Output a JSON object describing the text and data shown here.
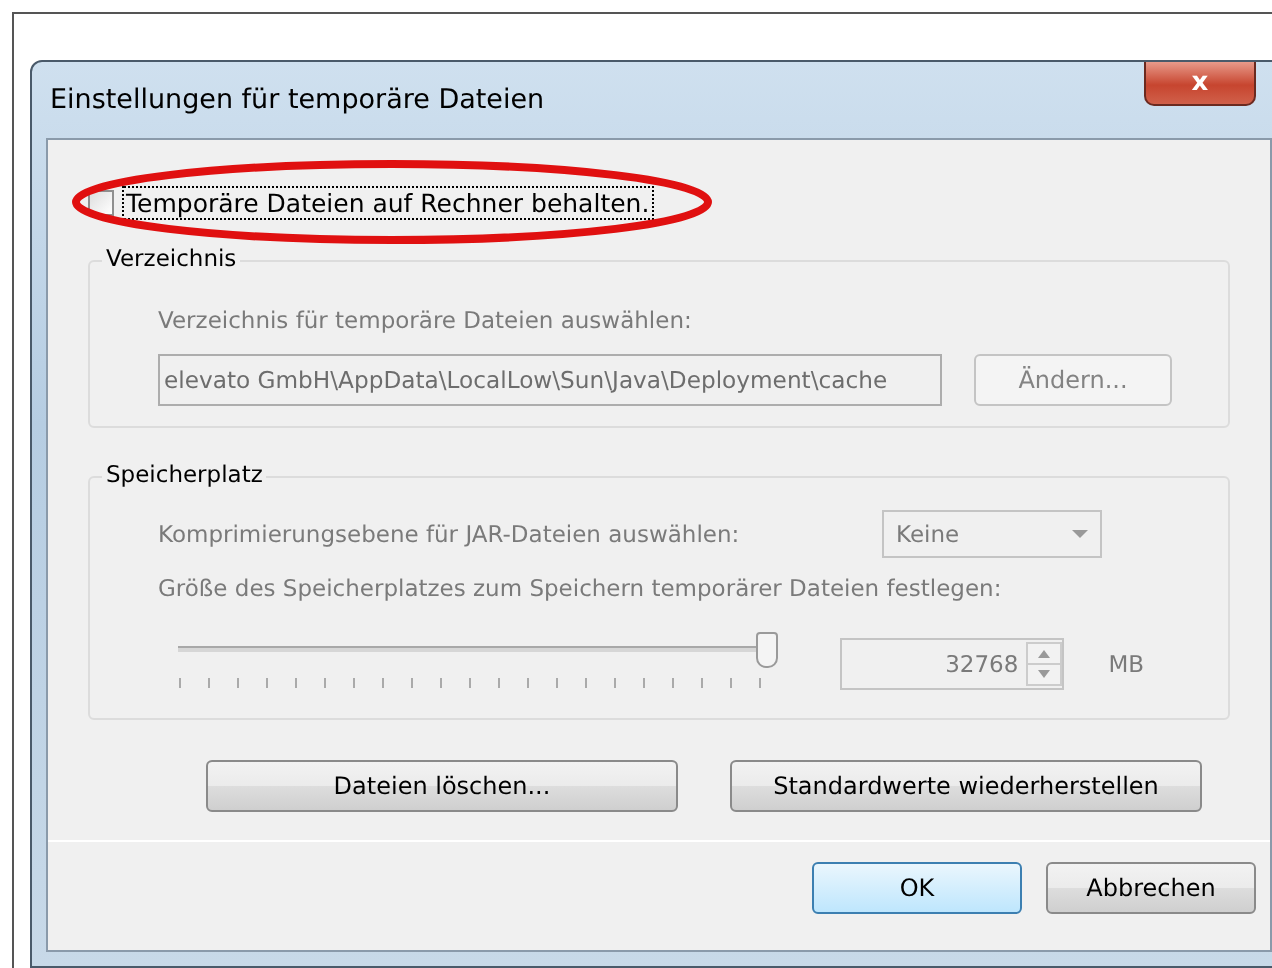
{
  "window": {
    "title": "Einstellungen für temporäre Dateien",
    "close_label": "x"
  },
  "keep_files": {
    "label": "Temporäre Dateien auf Rechner behalten.",
    "checked": false,
    "highlighted": true
  },
  "directory_group": {
    "title": "Verzeichnis",
    "disabled": true,
    "prompt": "Verzeichnis für temporäre Dateien auswählen:",
    "path": "elevato GmbH\\AppData\\LocalLow\\Sun\\Java\\Deployment\\cache",
    "change_button": "Ändern..."
  },
  "storage_group": {
    "title": "Speicherplatz",
    "disabled": true,
    "compression_label": "Komprimierungsebene für JAR-Dateien auswählen:",
    "compression_value": "Keine",
    "size_label": "Größe des Speicherplatzes zum Speichern temporärer Dateien festlegen:",
    "size_slider": {
      "level": 1.0
    },
    "size_value": "32768",
    "size_unit": "MB"
  },
  "action_buttons": [
    "Dateien löschen...",
    "Standardwerte wiederherstellen"
  ],
  "dialog_buttons": [
    {
      "label": "OK",
      "default": true
    },
    {
      "label": "Abbrechen",
      "default": false
    }
  ]
}
